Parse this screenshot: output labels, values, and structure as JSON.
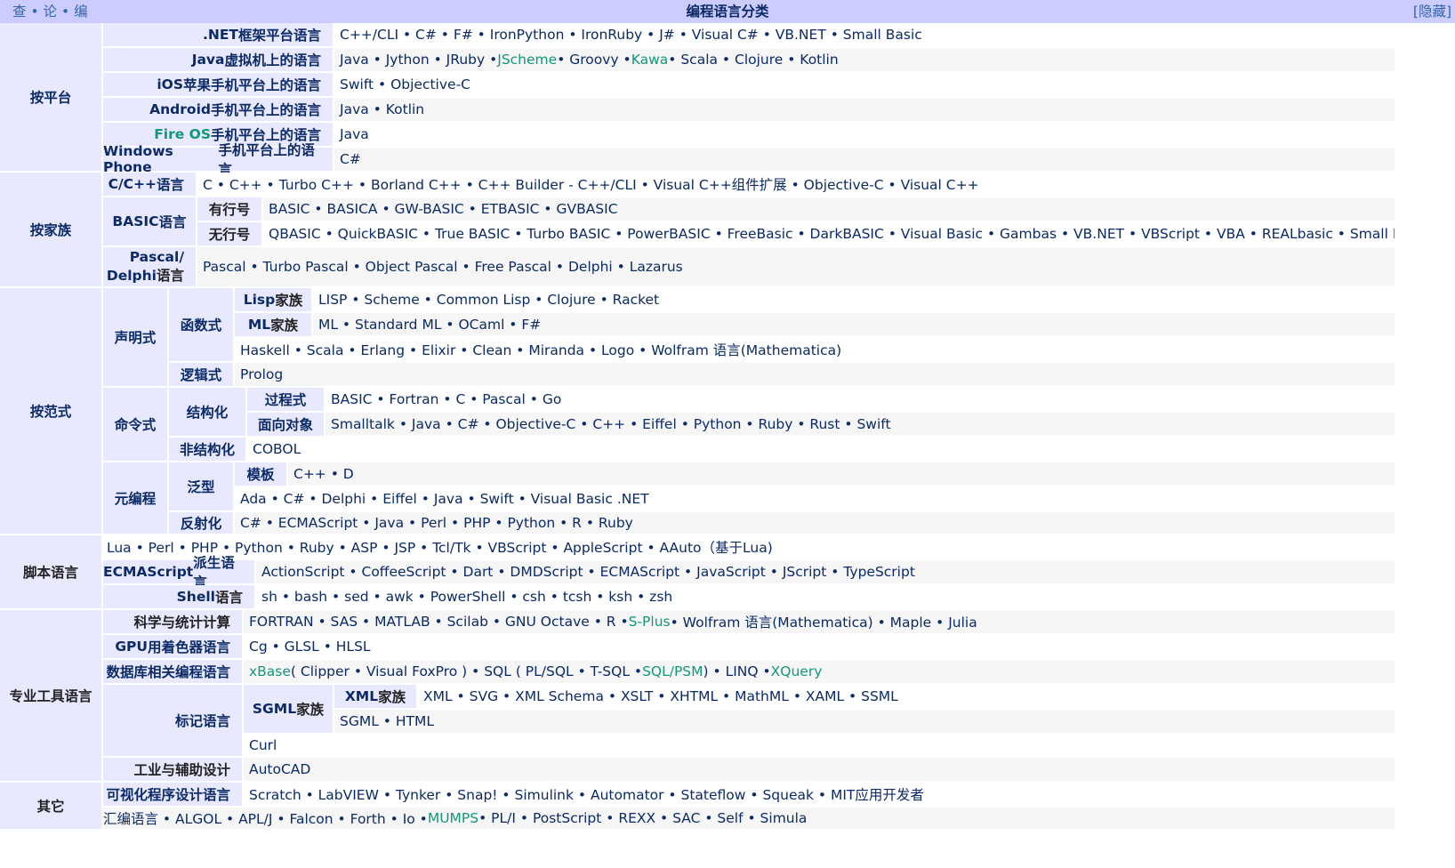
{
  "header": {
    "v": "查",
    "d": "论",
    "e": "编",
    "sep": "•",
    "title": "编程语言分类",
    "hide": "[隐藏]"
  },
  "groups": {
    "platform": "按平台",
    "family": "按家族",
    "paradigm": "按范式",
    "script": "脚本语言",
    "tools": "专业工具语言",
    "other": "其它"
  },
  "platform": [
    {
      "pre": ".NET",
      "post": "框架平台语言",
      "list": "C++/CLI • C# • F# • IronPython • IronRuby • J# • Visual C# • VB.NET • Small Basic"
    },
    {
      "pre": "Java",
      "post": "虚拟机上的语言",
      "l1": "Java • Jython • JRuby • ",
      "g1": "JScheme",
      "l2": " • Groovy • ",
      "g2": "Kawa",
      "l3": " • Scala • Clojure • Kotlin"
    },
    {
      "pre": "iOS",
      "post": "苹果手机平台上的语言",
      "list": "Swift • Objective-C"
    },
    {
      "pre": "Android",
      "post": "手机平台上的语言",
      "list": "Java • Kotlin"
    },
    {
      "pre": "Fire OS",
      "post": "手机平台上的语言",
      "list": "Java"
    },
    {
      "pre": "Windows Phone",
      "post": "手机平台上的语言",
      "list": "C#"
    }
  ],
  "family": {
    "c": {
      "pre": "C/C++",
      "post": "语言",
      "list": "C • C++ • Turbo C++ • Borland C++ • C++ Builder - C++/CLI • Visual C++组件扩展 • Objective-C • Visual C++"
    },
    "basic": {
      "pre": "BASIC",
      "post": "语言",
      "numbered": "有行号",
      "numbered_list": "BASIC • BASICA • GW-BASIC • ETBASIC • GVBASIC",
      "unnumbered": "无行号",
      "unnumbered_list": "QBASIC • QuickBASIC • True BASIC • Turbo BASIC • PowerBASIC • FreeBasic • DarkBASIC • Visual Basic • Gambas • VB.NET • VBScript • VBA • REALbasic • Small Basic"
    },
    "pascal": {
      "line1": "Pascal/",
      "pre2": "Delphi",
      "post2": "语言",
      "list": "Pascal • Turbo Pascal • Object Pascal • Free Pascal • Delphi • Lazarus"
    }
  },
  "paradigm": {
    "declarative": "声明式",
    "functional": "函数式",
    "lisp": {
      "pre": "Lisp",
      "post": "家族",
      "list": "LISP • Scheme • Common Lisp • Clojure • Racket"
    },
    "ml": {
      "pre": "ML",
      "post": "家族",
      "list": "ML • Standard ML • OCaml • F#"
    },
    "functional_other": "Haskell • Scala • Erlang • Elixir • Clean • Miranda • Logo • Wolfram 语言(Mathematica)",
    "logic": "逻辑式",
    "logic_list": "Prolog",
    "imperative": "命令式",
    "structured": "结构化",
    "procedural": "过程式",
    "procedural_list": "BASIC • Fortran • C • Pascal • Go",
    "oop": "面向对象",
    "oop_list": "Smalltalk • Java • C# • Objective-C • C++ • Eiffel • Python • Ruby • Rust • Swift",
    "unstructured": "非结构化",
    "unstructured_list": "COBOL",
    "meta": "元编程",
    "generic": "泛型",
    "template": "模板",
    "template_list": "C++ • D",
    "generic_other": "Ada • C# • Delphi • Eiffel • Java • Swift • Visual Basic .NET",
    "reflection": "反射化",
    "reflection_list": "C# • ECMAScript • Java • Perl • PHP • Python • R • Ruby"
  },
  "script": {
    "general": "Lua • Perl • PHP • Python • Ruby • ASP • JSP • Tcl/Tk • VBScript • AppleScript • AAuto（基于Lua)",
    "ecma": {
      "pre": "ECMAScript",
      "post": "派生语言",
      "list": "ActionScript • CoffeeScript • Dart • DMDScript • ECMAScript • JavaScript • JScript • TypeScript"
    },
    "shell": {
      "pre": "Shell",
      "post": "语言",
      "list": "sh • bash • sed • awk • PowerShell • csh • tcsh • ksh • zsh"
    }
  },
  "tools": {
    "science": {
      "label": "科学与统计计算",
      "l1": "FORTRAN • SAS • MATLAB • Scilab • GNU Octave • R • ",
      "g1": "S-Plus",
      "l2": " • Wolfram 语言(Mathematica) • Maple • Julia"
    },
    "gpu": {
      "pre": "GPU",
      "post": "用着色器语言",
      "list": "Cg • GLSL • HLSL"
    },
    "db": {
      "label": "数据库相关编程语言",
      "g1": "xBase",
      "l1": " ( Clipper • Visual FoxPro ) • SQL ( PL/SQL • T-SQL • ",
      "g2": "SQL/PSM",
      "l2": " ) • LINQ • ",
      "g3": "XQuery"
    },
    "markup": "标记语言",
    "sgml": {
      "pre": "SGML",
      "post": "家族"
    },
    "xml": {
      "pre": "XML",
      "post": "家族",
      "list": "XML • SVG • XML Schema • XSLT • XHTML • MathML • XAML • SSML"
    },
    "sgml_other": "SGML • HTML",
    "markup_other": "Curl",
    "industry": {
      "label": "工业与辅助设计",
      "list": "AutoCAD"
    }
  },
  "other": {
    "visual": {
      "label": "可视化程序设计语言",
      "list": "Scratch • LabVIEW • Tynker • Snap! • Simulink • Automator • Stateflow • Squeak • MIT应用开发者"
    },
    "misc": {
      "l1": "汇编语言 • ALGOL • APL/J • Falcon • Forth • Io • ",
      "g1": "MUMPS",
      "l2": " • PL/I • PostScript • REXX • SAC • Self • Simula"
    }
  },
  "colors": {
    "title_bar": "#ccccff",
    "group": "#e8e8ff",
    "link": "#0b2a66",
    "link_missing": "#119977",
    "alt_row": "#f6f6f6"
  }
}
